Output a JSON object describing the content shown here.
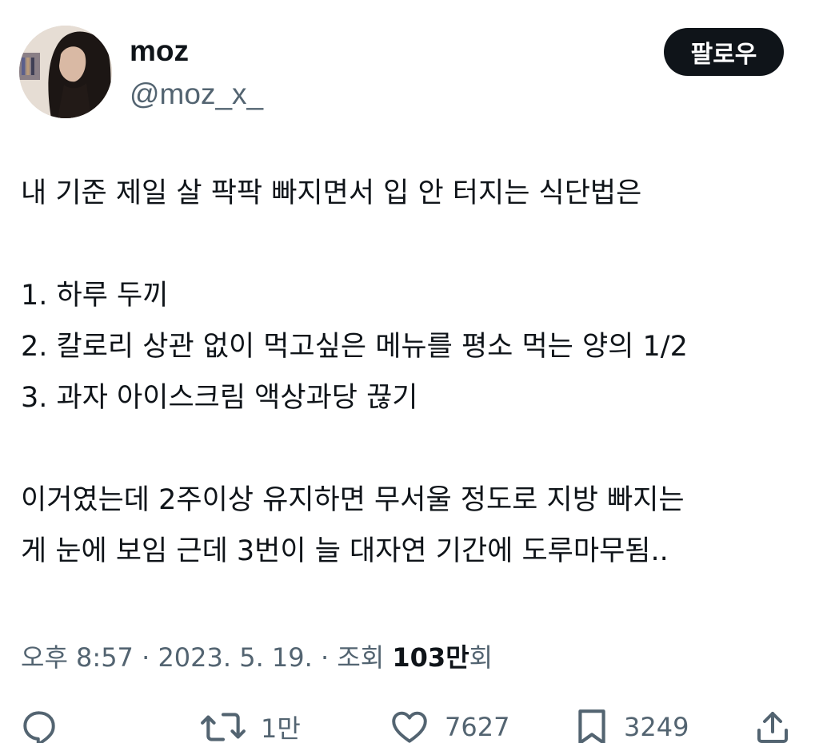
{
  "user": {
    "display_name": "moz",
    "handle": "@moz_x_"
  },
  "follow_button": {
    "label": "팔로우"
  },
  "tweet": {
    "lines": [
      "내 기준 제일 살 팍팍 빠지면서 입 안 터지는 식단법은",
      "1. 하루 두끼",
      "2. 칼로리 상관 없이 먹고싶은 메뉴를 평소 먹는 양의 1/2",
      "3. 과자 아이스크림 액상과당 끊기",
      "이거였는데 2주이상 유지하면 무서울 정도로 지방 빠지는",
      "게 눈에 보임 근데 3번이 늘 대자연 기간에 도루마무됨.."
    ]
  },
  "meta": {
    "time": "오후 8:57",
    "separator": "·",
    "date": "2023. 5. 19.",
    "views_label": "조회",
    "views_count": "103만",
    "views_suffix": "회"
  },
  "actions": {
    "reply": {
      "icon": "reply-icon",
      "count": ""
    },
    "retweet": {
      "icon": "retweet-icon",
      "count": "1만"
    },
    "like": {
      "icon": "heart-icon",
      "count": "7627"
    },
    "bookmark": {
      "icon": "bookmark-icon",
      "count": "3249"
    },
    "share": {
      "icon": "share-icon",
      "count": ""
    }
  },
  "colors": {
    "text_primary": "#0f1419",
    "text_secondary": "#536471",
    "button_bg": "#0f1419",
    "button_text": "#ffffff"
  }
}
